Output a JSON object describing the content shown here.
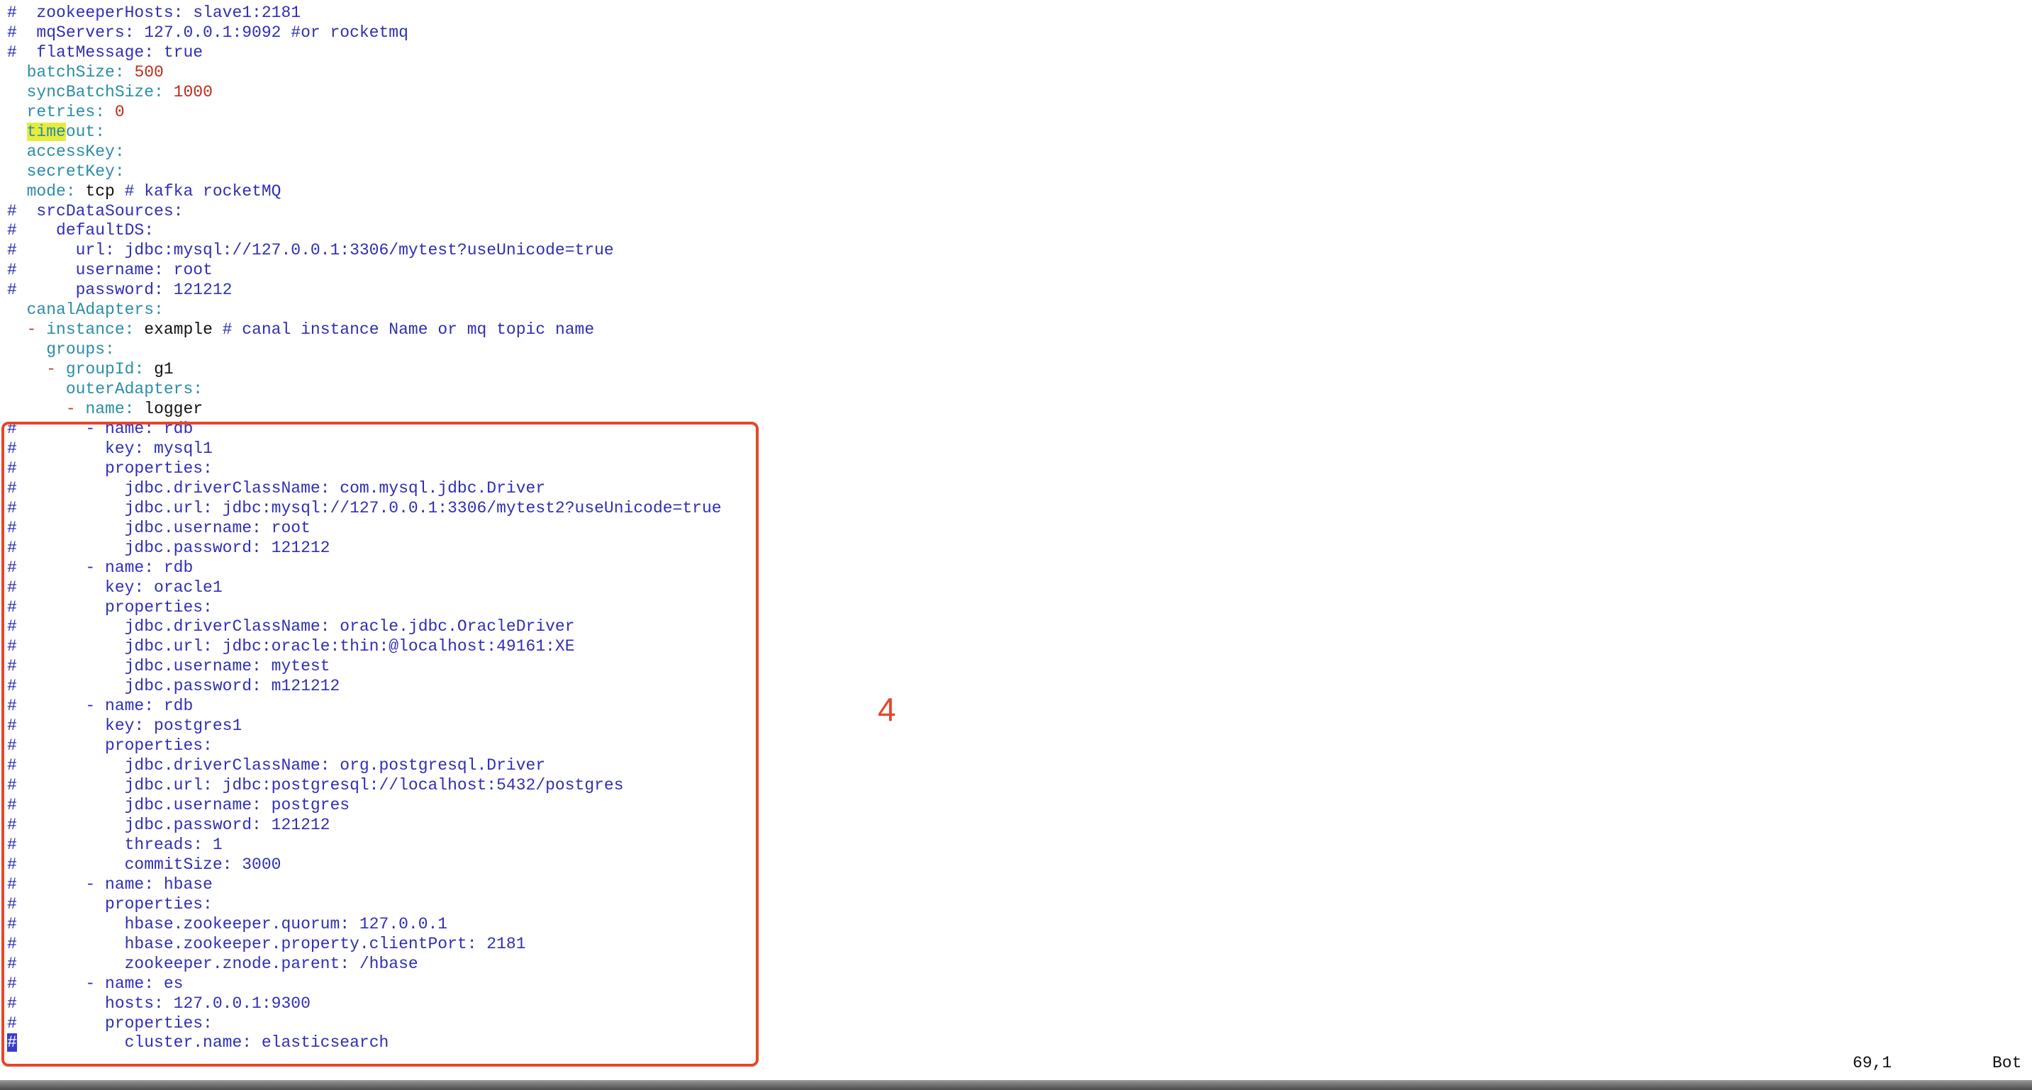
{
  "editor": {
    "lines": [
      [
        {
          "t": "#  zookeeperHosts: slave1:2181",
          "c": "comment"
        }
      ],
      [
        {
          "t": "#  mqServers: 127.0.0.1:9092 #or rocketmq",
          "c": "comment"
        }
      ],
      [
        {
          "t": "#  flatMessage: true",
          "c": "comment"
        }
      ],
      [
        {
          "t": "  batchSize",
          "c": "key"
        },
        {
          "t": ": ",
          "c": "key"
        },
        {
          "t": "500",
          "c": "num"
        }
      ],
      [
        {
          "t": "  syncBatchSize",
          "c": "key"
        },
        {
          "t": ": ",
          "c": "key"
        },
        {
          "t": "1000",
          "c": "num"
        }
      ],
      [
        {
          "t": "  retries",
          "c": "key"
        },
        {
          "t": ": ",
          "c": "key"
        },
        {
          "t": "0",
          "c": "num"
        }
      ],
      [
        {
          "t": "  ",
          "c": "key"
        },
        {
          "t": "time",
          "c": "hl"
        },
        {
          "t": "out:",
          "c": "key"
        }
      ],
      [
        {
          "t": "  accessKey:",
          "c": "key"
        }
      ],
      [
        {
          "t": "  secretKey:",
          "c": "key"
        }
      ],
      [
        {
          "t": "  mode: ",
          "c": "key"
        },
        {
          "t": "tcp ",
          "c": "plain"
        },
        {
          "t": "# kafka rocketMQ",
          "c": "comment"
        }
      ],
      [
        {
          "t": "#  srcDataSources:",
          "c": "comment"
        }
      ],
      [
        {
          "t": "#    defaultDS:",
          "c": "comment"
        }
      ],
      [
        {
          "t": "#      url: jdbc:mysql://127.0.0.1:3306/mytest?useUnicode=true",
          "c": "comment"
        }
      ],
      [
        {
          "t": "#      username: root",
          "c": "comment"
        }
      ],
      [
        {
          "t": "#      password: 121212",
          "c": "comment"
        }
      ],
      [
        {
          "t": "  canalAdapters:",
          "c": "key"
        }
      ],
      [
        {
          "t": "  ",
          "c": "key"
        },
        {
          "t": "- ",
          "c": "dash"
        },
        {
          "t": "instance: ",
          "c": "key"
        },
        {
          "t": "example ",
          "c": "plain"
        },
        {
          "t": "# canal instance Name or mq topic name",
          "c": "comment"
        }
      ],
      [
        {
          "t": "    groups:",
          "c": "key"
        }
      ],
      [
        {
          "t": "    ",
          "c": "key"
        },
        {
          "t": "- ",
          "c": "dash"
        },
        {
          "t": "groupId: ",
          "c": "key"
        },
        {
          "t": "g1",
          "c": "plain"
        }
      ],
      [
        {
          "t": "      outerAdapters:",
          "c": "key"
        }
      ],
      [
        {
          "t": "      ",
          "c": "key"
        },
        {
          "t": "- ",
          "c": "dash"
        },
        {
          "t": "name: ",
          "c": "key"
        },
        {
          "t": "logger",
          "c": "plain"
        }
      ],
      [
        {
          "t": "#       - name: rdb",
          "c": "comment"
        }
      ],
      [
        {
          "t": "#         key: mysql1",
          "c": "comment"
        }
      ],
      [
        {
          "t": "#         properties:",
          "c": "comment"
        }
      ],
      [
        {
          "t": "#           jdbc.driverClassName: com.mysql.jdbc.Driver",
          "c": "comment"
        }
      ],
      [
        {
          "t": "#           jdbc.url: jdbc:mysql://127.0.0.1:3306/mytest2?useUnicode=true",
          "c": "comment"
        }
      ],
      [
        {
          "t": "#           jdbc.username: root",
          "c": "comment"
        }
      ],
      [
        {
          "t": "#           jdbc.password: 121212",
          "c": "comment"
        }
      ],
      [
        {
          "t": "#       - name: rdb",
          "c": "comment"
        }
      ],
      [
        {
          "t": "#         key: oracle1",
          "c": "comment"
        }
      ],
      [
        {
          "t": "#         properties:",
          "c": "comment"
        }
      ],
      [
        {
          "t": "#           jdbc.driverClassName: oracle.jdbc.OracleDriver",
          "c": "comment"
        }
      ],
      [
        {
          "t": "#           jdbc.url: jdbc:oracle:thin:@localhost:49161:XE",
          "c": "comment"
        }
      ],
      [
        {
          "t": "#           jdbc.username: mytest",
          "c": "comment"
        }
      ],
      [
        {
          "t": "#           jdbc.password: m121212",
          "c": "comment"
        }
      ],
      [
        {
          "t": "#       - name: rdb",
          "c": "comment"
        }
      ],
      [
        {
          "t": "#         key: postgres1",
          "c": "comment"
        }
      ],
      [
        {
          "t": "#         properties:",
          "c": "comment"
        }
      ],
      [
        {
          "t": "#           jdbc.driverClassName: org.postgresql.Driver",
          "c": "comment"
        }
      ],
      [
        {
          "t": "#           jdbc.url: jdbc:postgresql://localhost:5432/postgres",
          "c": "comment"
        }
      ],
      [
        {
          "t": "#           jdbc.username: postgres",
          "c": "comment"
        }
      ],
      [
        {
          "t": "#           jdbc.password: 121212",
          "c": "comment"
        }
      ],
      [
        {
          "t": "#           threads: 1",
          "c": "comment"
        }
      ],
      [
        {
          "t": "#           commitSize: 3000",
          "c": "comment"
        }
      ],
      [
        {
          "t": "#       - name: hbase",
          "c": "comment"
        }
      ],
      [
        {
          "t": "#         properties:",
          "c": "comment"
        }
      ],
      [
        {
          "t": "#           hbase.zookeeper.quorum: 127.0.0.1",
          "c": "comment"
        }
      ],
      [
        {
          "t": "#           hbase.zookeeper.property.clientPort: 2181",
          "c": "comment"
        }
      ],
      [
        {
          "t": "#           zookeeper.znode.parent: /hbase",
          "c": "comment"
        }
      ],
      [
        {
          "t": "#       - name: es",
          "c": "comment"
        }
      ],
      [
        {
          "t": "#         hosts: 127.0.0.1:9300",
          "c": "comment"
        }
      ],
      [
        {
          "t": "#         properties:",
          "c": "comment"
        }
      ],
      [
        {
          "t": "#",
          "c": "cursor"
        },
        {
          "t": "           cluster.name: elasticsearch",
          "c": "comment"
        }
      ]
    ]
  },
  "annotation": {
    "number": "4"
  },
  "status_bar": {
    "position": "69,1",
    "scroll": "Bot"
  },
  "colors": {
    "comment": "#2f2fb5",
    "key": "#2a8da8",
    "number": "#c02a1a",
    "annotation": "#e8452a",
    "search_highlight": "#e7ec3c"
  }
}
